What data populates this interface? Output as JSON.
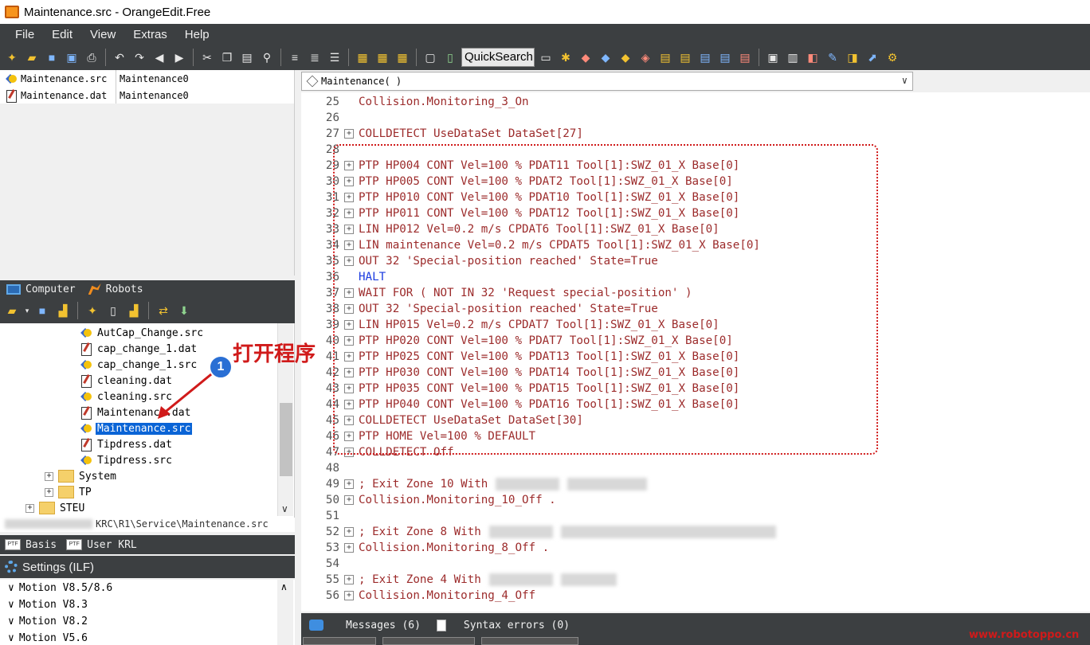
{
  "window": {
    "title": "Maintenance.src - OrangeEdit.Free"
  },
  "menu": [
    "File",
    "Edit",
    "View",
    "Extras",
    "Help"
  ],
  "toolbar": {
    "quicksearch_label": "QuickSearch"
  },
  "open_files": [
    {
      "name": "Maintenance.src",
      "module": "Maintenance0",
      "type": "src"
    },
    {
      "name": "Maintenance.dat",
      "module": "Maintenance0",
      "type": "dat"
    }
  ],
  "panel_tabs": {
    "computer": "Computer",
    "robots": "Robots"
  },
  "tree": {
    "items": [
      {
        "label": "AutCap_Change.src",
        "type": "src"
      },
      {
        "label": "cap_change_1.dat",
        "type": "dat"
      },
      {
        "label": "cap_change_1.src",
        "type": "src"
      },
      {
        "label": "cleaning.dat",
        "type": "dat"
      },
      {
        "label": "cleaning.src",
        "type": "src"
      },
      {
        "label": "Maintenance.dat",
        "type": "dat"
      },
      {
        "label": "Maintenance.src",
        "type": "src",
        "selected": true
      },
      {
        "label": "Tipdress.dat",
        "type": "dat"
      },
      {
        "label": "Tipdress.src",
        "type": "src"
      }
    ],
    "folders": [
      {
        "label": "System",
        "expander": "+"
      },
      {
        "label": "TP",
        "expander": "+"
      },
      {
        "label": "STEU",
        "expander": "+"
      }
    ],
    "status_path": "KRC\\R1\\Service\\Maintenance.src"
  },
  "basis_tabs": {
    "basis": "Basis",
    "user": "User KRL"
  },
  "settings": {
    "title": "Settings (ILF)",
    "items": [
      "Motion V8.5/8.6",
      "Motion V8.3",
      "Motion V8.2",
      "Motion V5.6"
    ]
  },
  "editor": {
    "function_selector": "Maintenance( )",
    "lines": [
      {
        "n": "25",
        "fold": "",
        "text": "Collision.Monitoring_3_On",
        "kw": false
      },
      {
        "n": "26",
        "fold": "",
        "text": "",
        "kw": false
      },
      {
        "n": "27",
        "fold": "+",
        "text": "COLLDETECT UseDataSet DataSet[27]",
        "kw": false
      },
      {
        "n": "28",
        "fold": "",
        "text": "",
        "kw": false
      },
      {
        "n": "29",
        "fold": "+",
        "text": "PTP HP004 CONT Vel=100 % PDAT11 Tool[1]:SWZ_01_X Base[0]",
        "kw": false
      },
      {
        "n": "30",
        "fold": "+",
        "text": "PTP HP005 CONT Vel=100 % PDAT2 Tool[1]:SWZ_01_X Base[0]",
        "kw": false
      },
      {
        "n": "31",
        "fold": "+",
        "text": "PTP HP010 CONT Vel=100 % PDAT10 Tool[1]:SWZ_01_X Base[0]",
        "kw": false
      },
      {
        "n": "32",
        "fold": "+",
        "text": "PTP HP011 CONT Vel=100 % PDAT12 Tool[1]:SWZ_01_X Base[0]",
        "kw": false
      },
      {
        "n": "33",
        "fold": "+",
        "text": "LIN HP012 Vel=0.2 m/s CPDAT6 Tool[1]:SWZ_01_X Base[0]",
        "kw": false
      },
      {
        "n": "34",
        "fold": "+",
        "text": "LIN maintenance Vel=0.2 m/s CPDAT5 Tool[1]:SWZ_01_X Base[0]",
        "kw": false
      },
      {
        "n": "35",
        "fold": "+",
        "text": "OUT 32 'Special-position reached' State=True",
        "kw": false
      },
      {
        "n": "36",
        "fold": "",
        "text": "HALT",
        "kw": true
      },
      {
        "n": "37",
        "fold": "+",
        "text": "WAIT FOR ( NOT IN 32 'Request special-position' )",
        "kw": false
      },
      {
        "n": "38",
        "fold": "+",
        "text": "OUT 32 'Special-position reached' State=True",
        "kw": false
      },
      {
        "n": "39",
        "fold": "+",
        "text": "LIN HP015 Vel=0.2 m/s CPDAT7 Tool[1]:SWZ_01_X Base[0]",
        "kw": false
      },
      {
        "n": "40",
        "fold": "+",
        "text": "PTP HP020 CONT Vel=100 % PDAT7 Tool[1]:SWZ_01_X Base[0]",
        "kw": false
      },
      {
        "n": "41",
        "fold": "+",
        "text": "PTP HP025 CONT Vel=100 % PDAT13 Tool[1]:SWZ_01_X Base[0]",
        "kw": false
      },
      {
        "n": "42",
        "fold": "+",
        "text": "PTP HP030 CONT Vel=100 % PDAT14 Tool[1]:SWZ_01_X Base[0]",
        "kw": false
      },
      {
        "n": "43",
        "fold": "+",
        "text": "PTP HP035 CONT Vel=100 % PDAT15 Tool[1]:SWZ_01_X Base[0]",
        "kw": false
      },
      {
        "n": "44",
        "fold": "+",
        "text": "PTP HP040 CONT Vel=100 % PDAT16 Tool[1]:SWZ_01_X Base[0]",
        "kw": false
      },
      {
        "n": "45",
        "fold": "+",
        "text": "COLLDETECT UseDataSet DataSet[30]",
        "kw": false
      },
      {
        "n": "46",
        "fold": "+",
        "text": "PTP HOME Vel=100 % DEFAULT",
        "kw": false
      },
      {
        "n": "47",
        "fold": "+",
        "text": "COLLDETECT Off",
        "kw": false
      },
      {
        "n": "48",
        "fold": "",
        "text": "",
        "kw": false
      },
      {
        "n": "49",
        "fold": "+",
        "text": "; Exit Zone 10 With",
        "kw": false,
        "redacted": true
      },
      {
        "n": "50",
        "fold": "+",
        "text": "Collision.Monitoring_10_Off .",
        "kw": false
      },
      {
        "n": "51",
        "fold": "",
        "text": "",
        "kw": false
      },
      {
        "n": "52",
        "fold": "+",
        "text": "; Exit Zone 8 With",
        "kw": false,
        "redacted": true
      },
      {
        "n": "53",
        "fold": "+",
        "text": "Collision.Monitoring_8_Off .",
        "kw": false
      },
      {
        "n": "54",
        "fold": "",
        "text": "",
        "kw": false
      },
      {
        "n": "55",
        "fold": "+",
        "text": "; Exit Zone 4 With",
        "kw": false,
        "redacted": true
      },
      {
        "n": "56",
        "fold": "+",
        "text": "Collision.Monitoring_4_Off",
        "kw": false
      }
    ]
  },
  "annotation": {
    "text": "打开程序",
    "badge": "1"
  },
  "messages_bar": {
    "messages": "Messages (6)",
    "syntax": "Syntax errors (0)"
  },
  "watermark": "www.robotoppo.cn",
  "colors": {
    "code_text": "#9c2b2b",
    "keyword": "#1a3be0",
    "selection": "#0a64d6",
    "annotation": "#d01a1a",
    "dark_chrome": "#3c3f41"
  }
}
